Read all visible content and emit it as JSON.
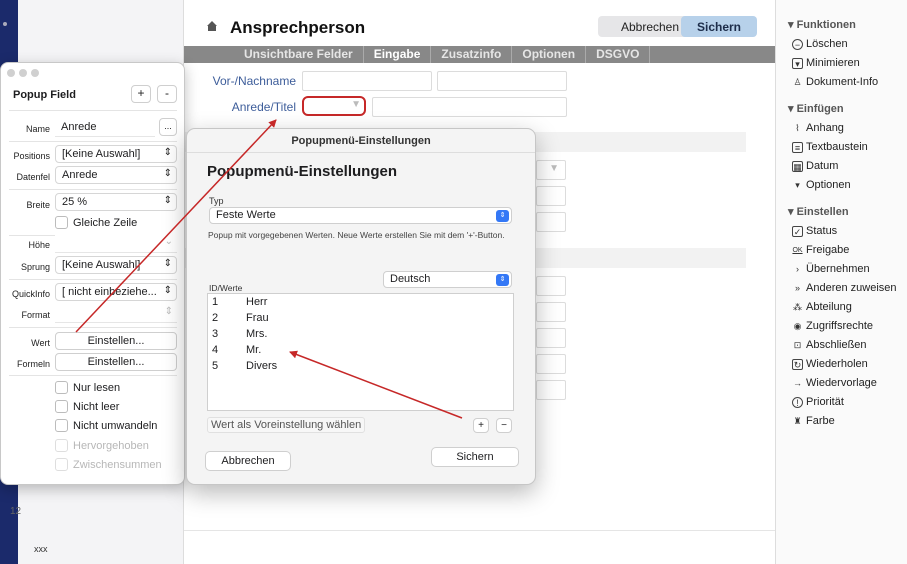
{
  "main": {
    "title": "Ansprechperson",
    "cancel_label": "Abbrechen",
    "save_label": "Sichern",
    "tabs": [
      {
        "label": "Unsichtbare Felder",
        "active": false
      },
      {
        "label": "Eingabe",
        "active": true
      },
      {
        "label": "Zusatzinfo",
        "active": false
      },
      {
        "label": "Optionen",
        "active": false
      },
      {
        "label": "DSGVO",
        "active": false
      }
    ],
    "fields": {
      "name_label": "Vor-/Nachname",
      "title_label": "Anrede/Titel"
    }
  },
  "left_pane": {
    "footer_text": "xxx",
    "row_number": "12"
  },
  "sidebar": {
    "sections": [
      {
        "heading": "Funktionen",
        "items": [
          {
            "label": "Löschen",
            "icon": "minus-circle-icon"
          },
          {
            "label": "Minimieren",
            "icon": "minimize-icon"
          },
          {
            "label": "Dokument-Info",
            "icon": "document-info-icon"
          }
        ]
      },
      {
        "heading": "Einfügen",
        "items": [
          {
            "label": "Anhang",
            "icon": "paperclip-icon"
          },
          {
            "label": "Textbaustein",
            "icon": "text-block-icon"
          },
          {
            "label": "Datum",
            "icon": "calendar-icon"
          },
          {
            "label": "Optionen",
            "icon": "small-triangle-icon"
          }
        ]
      },
      {
        "heading": "Einstellen",
        "items": [
          {
            "label": "Status",
            "icon": "checkbox-icon"
          },
          {
            "label": "Freigabe",
            "icon": "ok-icon"
          },
          {
            "label": "Übernehmen",
            "icon": "take-over-icon"
          },
          {
            "label": "Anderen zuweisen",
            "icon": "assign-icon"
          },
          {
            "label": "Abteilung",
            "icon": "org-chart-icon"
          },
          {
            "label": "Zugriffsrechte",
            "icon": "eye-icon"
          },
          {
            "label": "Abschließen",
            "icon": "lock-icon"
          },
          {
            "label": "Wiederholen",
            "icon": "repeat-icon"
          },
          {
            "label": "Wiedervorlage",
            "icon": "resubmit-icon"
          },
          {
            "label": "Priorität",
            "icon": "priority-icon"
          },
          {
            "label": "Farbe",
            "icon": "paint-icon"
          }
        ]
      }
    ]
  },
  "inspector": {
    "title": "Popup Field",
    "add_label": "+",
    "remove_label": "-",
    "name_label": "Name",
    "name_value": "Anrede",
    "name_more": "...",
    "positions_label": "Positions",
    "positions_value": "[Keine Auswahl]",
    "datenfel_label": "Datenfel",
    "datenfel_value": "Anrede",
    "breite_label": "Breite",
    "breite_value": "25 %",
    "gleiche_zeile": "Gleiche Zeile",
    "hoehe_label": "Höhe",
    "hoehe_value": "",
    "sprung_label": "Sprung",
    "sprung_value": "[Keine Auswahl]",
    "quickinfo_label": "QuickInfo",
    "quickinfo_value": "[ nicht einbeziehe...",
    "format_label": "Format",
    "format_value": "",
    "wert_label": "Wert",
    "wert_button": "Einstellen...",
    "formeln_label": "Formeln",
    "formeln_button": "Einstellen...",
    "checkboxes": [
      {
        "label": "Nur lesen",
        "enabled": true
      },
      {
        "label": "Nicht leer",
        "enabled": true
      },
      {
        "label": "Nicht umwandeln",
        "enabled": true
      },
      {
        "label": "Hervorgehoben",
        "enabled": false
      },
      {
        "label": "Zwischensummen",
        "enabled": false
      }
    ]
  },
  "dialog": {
    "window_title": "Popupmenü-Einstellungen",
    "heading": "Popupmenü-Einstellungen",
    "typ_label": "Typ",
    "typ_value": "Feste Werte",
    "help_text": "Popup mit vorgegebenen Werten. Neue Werte erstellen Sie mit dem '+'-Button.",
    "language_value": "Deutsch",
    "list_label": "ID/Werte",
    "rows": [
      {
        "id": "1",
        "value": "Herr"
      },
      {
        "id": "2",
        "value": "Frau"
      },
      {
        "id": "3",
        "value": "Mrs."
      },
      {
        "id": "4",
        "value": "Mr."
      },
      {
        "id": "5",
        "value": "Divers"
      }
    ],
    "default_button": "Wert als Voreinstellung wählen",
    "add_label": "+",
    "remove_label": "−",
    "cancel_label": "Abbrechen",
    "save_label": "Sichern"
  },
  "colors": {
    "accent": "#3478f6",
    "annotation": "#c62828",
    "save_button": "#b7d1ea",
    "label_blue": "#3d5d9a"
  }
}
